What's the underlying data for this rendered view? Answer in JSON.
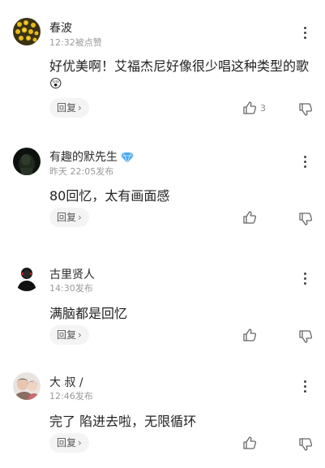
{
  "comments": [
    {
      "name": "春波",
      "meta": "12:32被点赞",
      "content": "好优美啊！艾福杰尼好像很少唱这种类型的歌",
      "emoji": "😲",
      "reply_label": "回复",
      "like_count": "3"
    },
    {
      "name": "有趣的默先生",
      "meta": "昨天 22:05发布",
      "content": "80回忆，太有画面感",
      "reply_label": "回复",
      "like_count": ""
    },
    {
      "name": "古里贤人",
      "meta": "14:30发布",
      "content": "满脑都是回忆",
      "reply_label": "回复",
      "like_count": ""
    },
    {
      "name": "大 叔 /",
      "meta": "12:46发布",
      "content": "完了 陷进去啦，无限循环",
      "reply_label": "回复",
      "like_count": ""
    }
  ],
  "icons": {
    "more": "more-vertical-icon",
    "like": "thumbs-up-icon",
    "dislike": "thumbs-down-icon",
    "chevron": "chevron-right-icon",
    "verified": "diamond-badge-icon"
  },
  "colors": {
    "verified_badge": "#4aa8f0",
    "meta_text": "#9a9a9a",
    "reply_bg": "#f4f4f4"
  }
}
